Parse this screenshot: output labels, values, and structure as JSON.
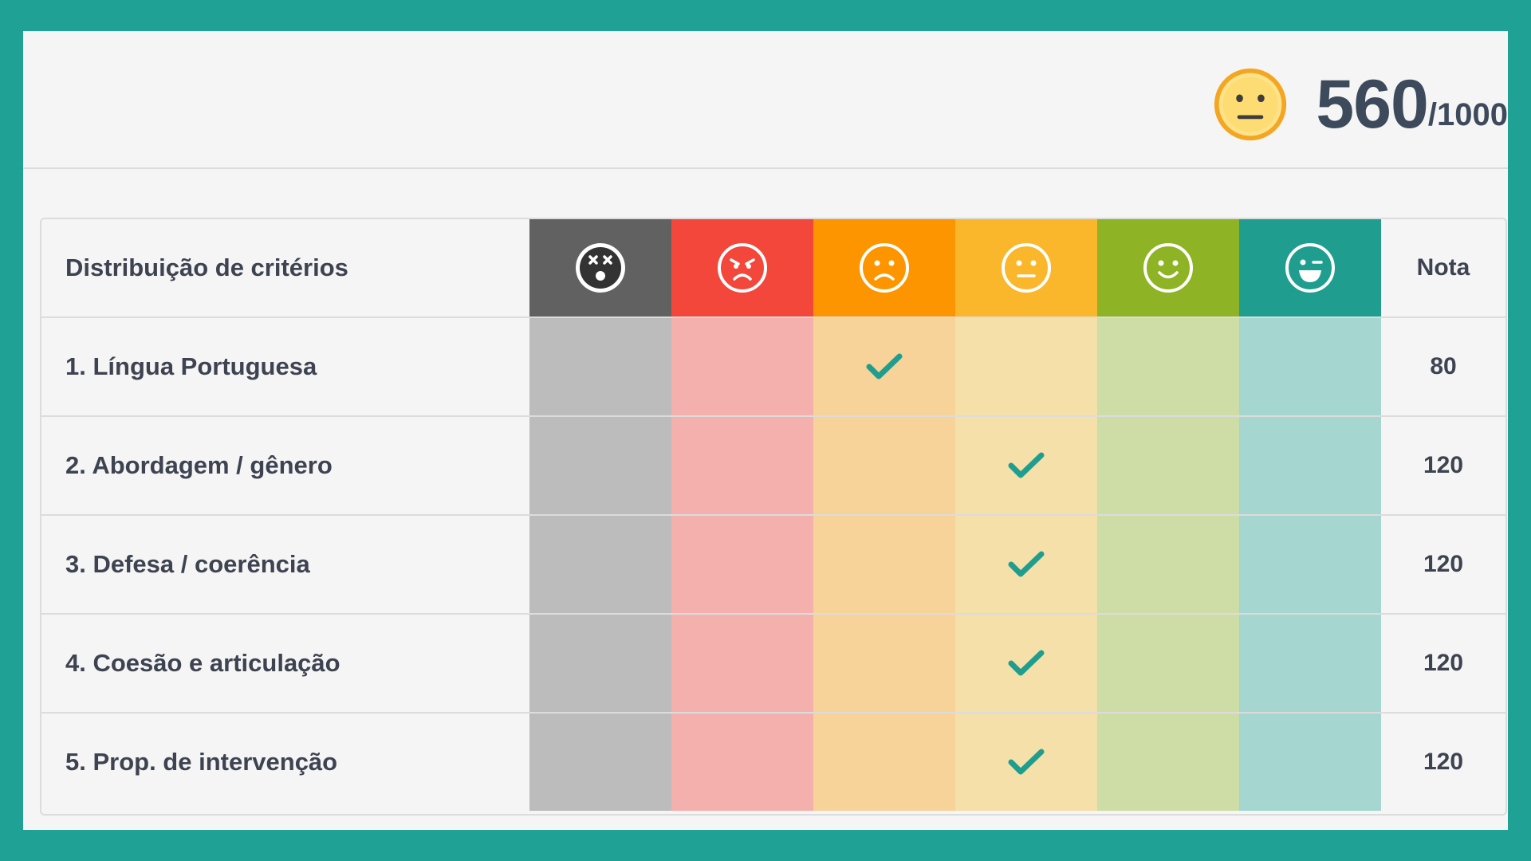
{
  "score": {
    "value": "560",
    "total": "/1000",
    "face_icon": "neutral-face-icon",
    "face_color": "#f9c32b"
  },
  "table": {
    "header_label": "Distribuição de critérios",
    "nota_label": "Nota",
    "levels": [
      {
        "icon": "dizzy-face-icon",
        "color": "#616161",
        "tint": "#bcbcbc"
      },
      {
        "icon": "angry-face-icon",
        "color": "#f3473b",
        "tint": "#f4b0ad"
      },
      {
        "icon": "sad-face-icon",
        "color": "#fd9500",
        "tint": "#f7d299"
      },
      {
        "icon": "neutral-face-icon",
        "color": "#fbb72b",
        "tint": "#f6e0a9"
      },
      {
        "icon": "smile-face-icon",
        "color": "#8eb324",
        "tint": "#cedda5"
      },
      {
        "icon": "wink-face-icon",
        "color": "#1f9e8f",
        "tint": "#a5d6d0"
      }
    ],
    "rows": [
      {
        "label": "1. Língua Portuguesa",
        "level": 2,
        "nota": "80"
      },
      {
        "label": "2. Abordagem / gênero",
        "level": 3,
        "nota": "120"
      },
      {
        "label": "3. Defesa / coerência",
        "level": 3,
        "nota": "120"
      },
      {
        "label": "4. Coesão e articulação",
        "level": 3,
        "nota": "120"
      },
      {
        "label": "5. Prop. de intervenção",
        "level": 3,
        "nota": "120"
      }
    ],
    "check_icon": "check-icon",
    "check_color": "#1f9e8f"
  }
}
